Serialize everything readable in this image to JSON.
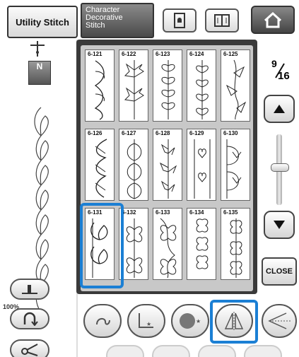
{
  "tabs": {
    "utility": "Utility Stitch",
    "character_line1": "Character",
    "character_line2": "Decorative",
    "character_line3": "Stitch"
  },
  "top_icons": [
    "lock-icon",
    "book-icon",
    "home-icon"
  ],
  "presser_foot_label": "N",
  "zoom_label": "100%",
  "page": {
    "current": "9",
    "total": "16"
  },
  "close_label": "CLOSE",
  "patterns": [
    {
      "label": "6-121"
    },
    {
      "label": "6-122"
    },
    {
      "label": "6-123"
    },
    {
      "label": "6-124"
    },
    {
      "label": "6-125"
    },
    {
      "label": "6-126"
    },
    {
      "label": "6-127"
    },
    {
      "label": "6-128"
    },
    {
      "label": "6-129"
    },
    {
      "label": "6-130"
    },
    {
      "label": "6-131"
    },
    {
      "label": "6-132"
    },
    {
      "label": "6-133"
    },
    {
      "label": "6-134"
    },
    {
      "label": "6-135"
    }
  ],
  "selected_pattern": "6-131",
  "highlight_color": "#1b7fd4",
  "bottom_icons": [
    "thread-cutter-icon",
    "elongation-icon",
    "density-icon",
    "mirror-icon",
    "needle-position-icon"
  ]
}
